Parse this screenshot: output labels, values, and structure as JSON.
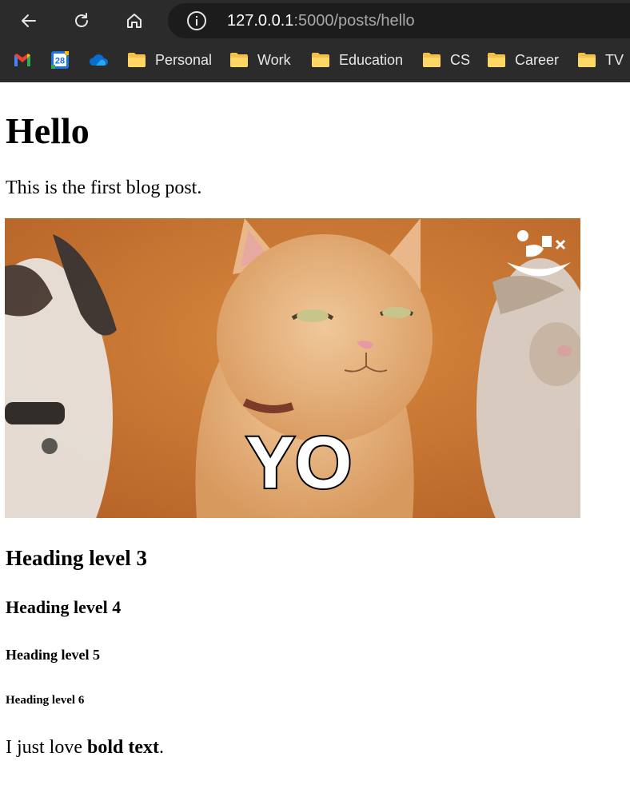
{
  "browser": {
    "url_host": "127.0.0.1",
    "url_path": ":5000/posts/hello",
    "bookmarks": [
      {
        "icon": "gmail-icon"
      },
      {
        "icon": "calendar-icon",
        "text": "28"
      },
      {
        "icon": "onedrive-icon"
      },
      {
        "icon": "folder-icon",
        "label": "Personal"
      },
      {
        "icon": "folder-icon",
        "label": "Work"
      },
      {
        "icon": "folder-icon",
        "label": "Education"
      },
      {
        "icon": "folder-icon",
        "label": "CS"
      },
      {
        "icon": "folder-icon",
        "label": "Career"
      },
      {
        "icon": "folder-icon",
        "label": "TV"
      }
    ]
  },
  "post": {
    "title": "Hello",
    "intro": "This is the first blog post.",
    "gif_caption": "YO",
    "h3": "Heading level 3",
    "h4": "Heading level 4",
    "h5": "Heading level 5",
    "h6": "Heading level 6",
    "outro_prefix": "I just love ",
    "outro_bold": "bold text",
    "outro_suffix": "."
  },
  "colors": {
    "chrome_bg": "#2b2b2b",
    "omnibox_bg": "#1c1c1c",
    "folder": "#f3c04a",
    "gif_bg": "#c8752e"
  }
}
